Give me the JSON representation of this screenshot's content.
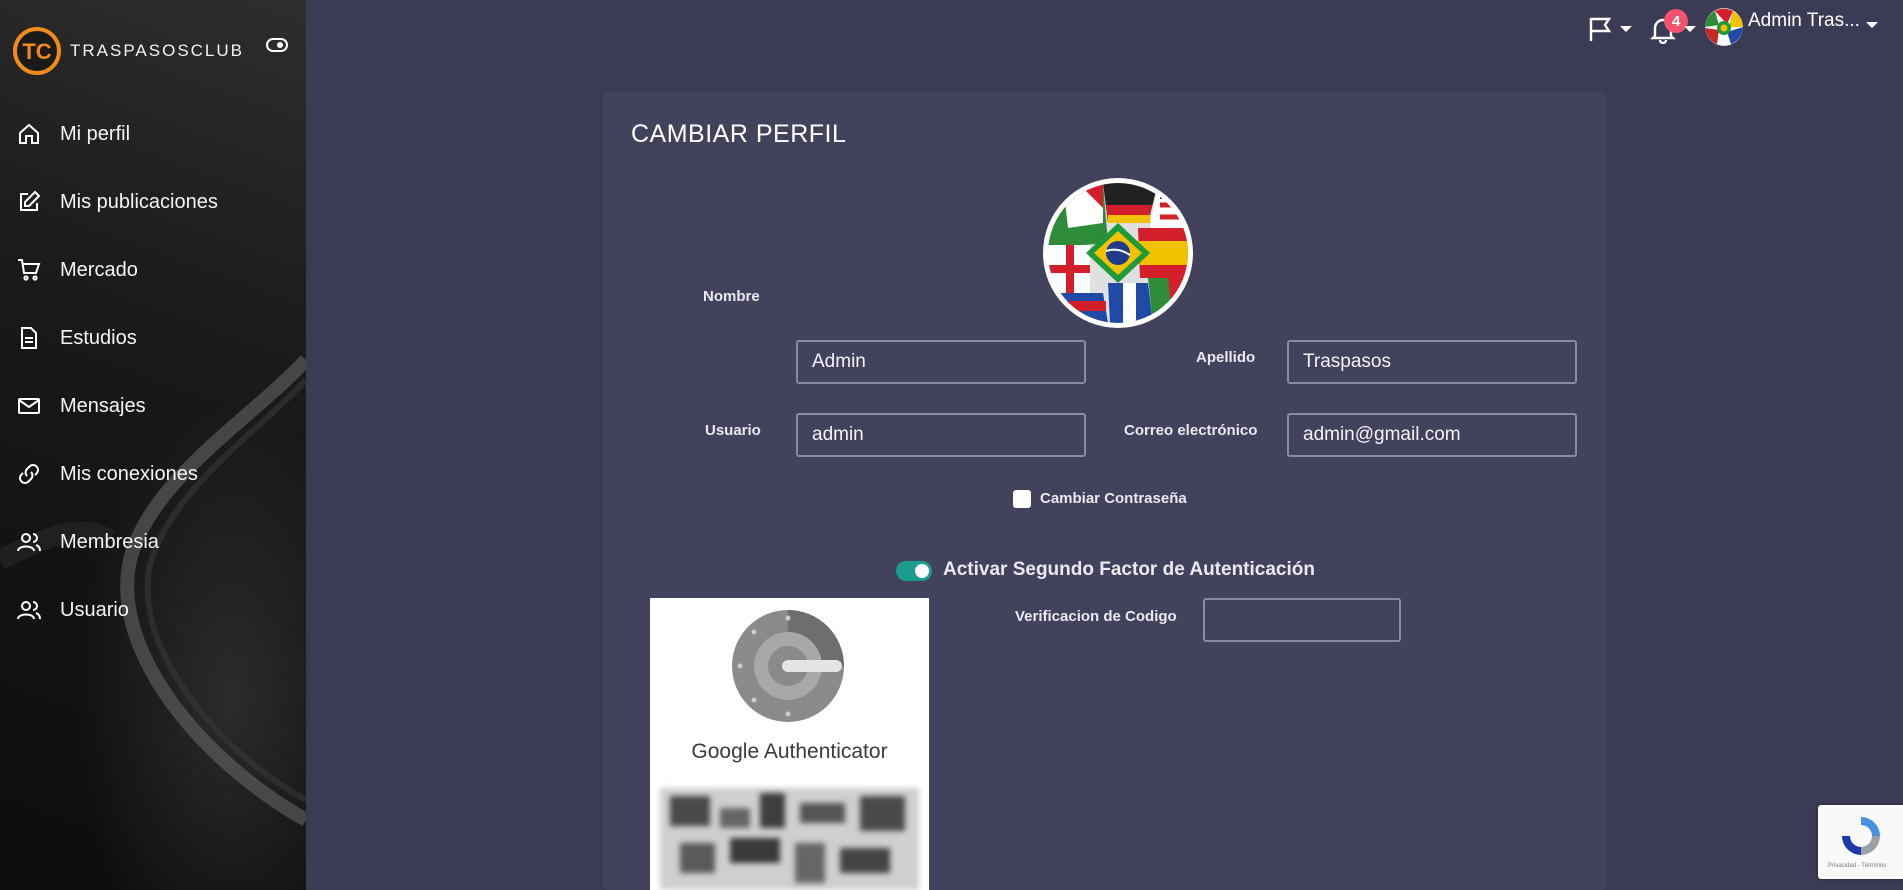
{
  "brand": {
    "name": "TRASPASOSCLUB",
    "logo_text": "TC"
  },
  "sidebar": {
    "items": [
      {
        "label": "Mi perfil",
        "icon": "home-icon"
      },
      {
        "label": "Mis publicaciones",
        "icon": "edit-icon"
      },
      {
        "label": "Mercado",
        "icon": "cart-icon"
      },
      {
        "label": "Estudios",
        "icon": "document-icon"
      },
      {
        "label": "Mensajes",
        "icon": "mail-icon"
      },
      {
        "label": "Mis conexiones",
        "icon": "link-icon"
      },
      {
        "label": "Membresia",
        "icon": "users-icon"
      },
      {
        "label": "Usuario",
        "icon": "users-icon"
      }
    ]
  },
  "topbar": {
    "notification_count": "4",
    "user_name": "Admin Tras..."
  },
  "profile": {
    "title": "CAMBIAR PERFIL",
    "fields": {
      "nombre": {
        "label": "Nombre",
        "value": "Admin"
      },
      "apellido": {
        "label": "Apellido",
        "value": "Traspasos"
      },
      "usuario": {
        "label": "Usuario",
        "value": "admin"
      },
      "correo": {
        "label": "Correo electrónico",
        "value": "admin@gmail.com"
      }
    },
    "change_password_label": "Cambiar Contraseña",
    "two_factor_label": "Activar Segundo Factor de Autenticación",
    "two_factor_enabled": true,
    "authenticator_title": "Google Authenticator",
    "verification_label": "Verificacion de Codigo",
    "verification_value": ""
  },
  "recaptcha": {
    "text": "Privacidad - Términos"
  },
  "colors": {
    "background": "#3c3b55",
    "card": "#43425d",
    "accent": "#1a9c8e",
    "badge": "#f4516c"
  }
}
